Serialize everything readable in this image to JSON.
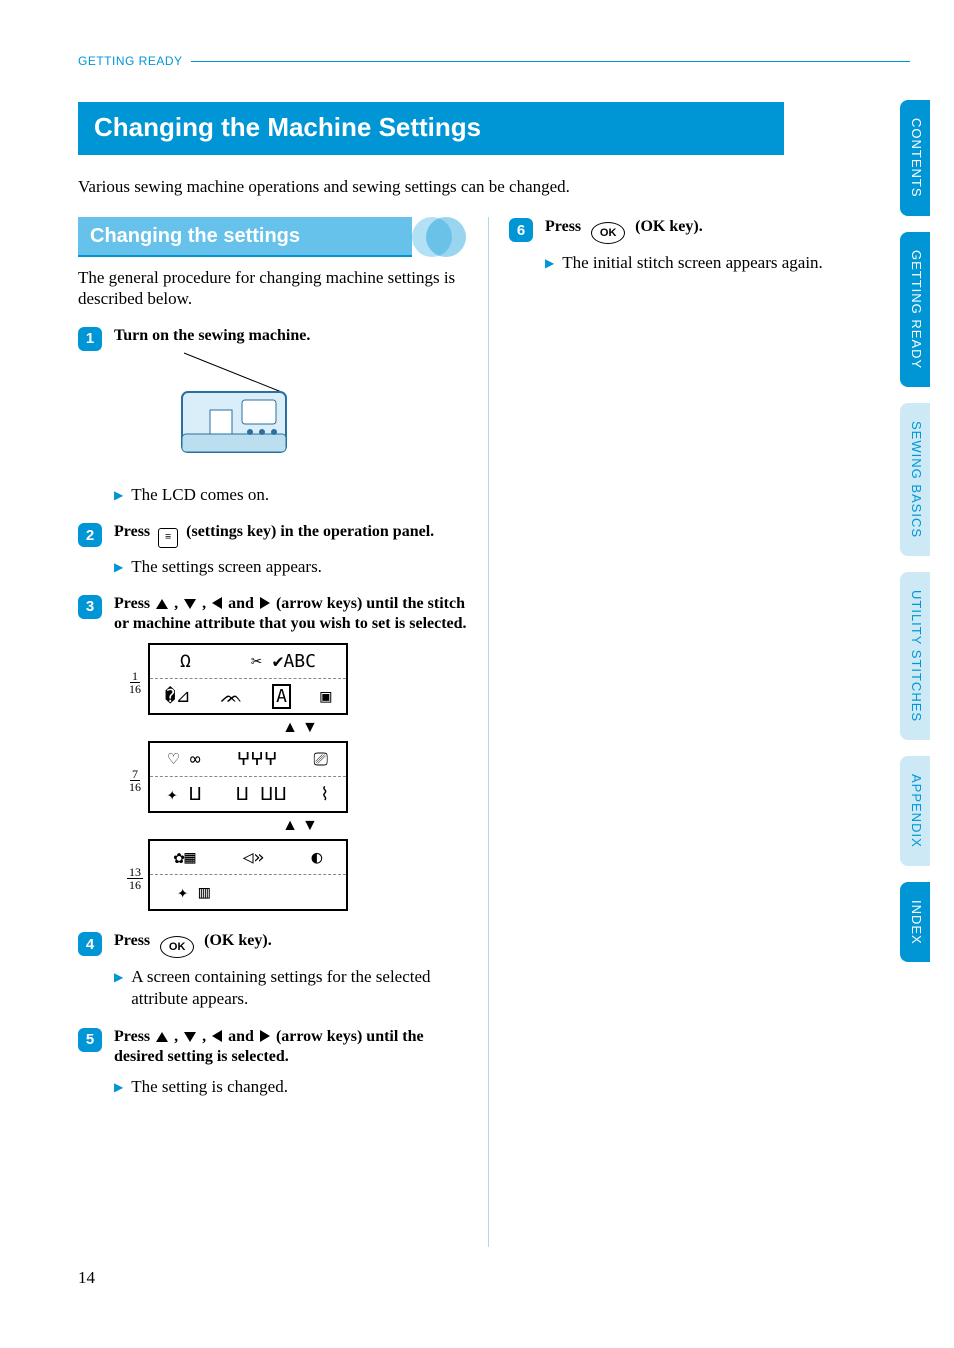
{
  "header": {
    "section": "GETTING READY"
  },
  "title": "Changing the Machine Settings",
  "intro": "Various sewing machine operations and sewing settings can be changed.",
  "subheading": "Changing the settings",
  "subintro": "The general procedure for changing machine settings is described below.",
  "steps": {
    "s1": {
      "num": "1",
      "head": "Turn on the sewing machine.",
      "result": "The LCD comes on."
    },
    "s2": {
      "num": "2",
      "head_pre": "Press ",
      "head_post": " (settings key) in the operation panel.",
      "result": "The settings screen appears."
    },
    "s3": {
      "num": "3",
      "head_pre": "Press ",
      "head_mid": " and ",
      "head_post": " (arrow keys) until the stitch or machine attribute that you wish to set is selected."
    },
    "s4": {
      "num": "4",
      "head_pre": "Press ",
      "head_post": " (OK key).",
      "result": "A screen containing settings for the selected attribute appears."
    },
    "s5": {
      "num": "5",
      "head_pre": "Press ",
      "head_mid": " and ",
      "head_post": " (arrow keys) until the desired setting is selected.",
      "result": "The setting is changed."
    },
    "s6": {
      "num": "6",
      "head_pre": "Press ",
      "head_post": " (OK key).",
      "result": "The initial stitch screen appears again."
    }
  },
  "lcd": {
    "page1": {
      "num": "1",
      "den": "16",
      "row1": "✂ ✔ABC",
      "row2_boxed": "A",
      "row2_rest": "▣"
    },
    "page2": {
      "num": "7",
      "den": "16"
    },
    "page3": {
      "num": "13",
      "den": "16"
    }
  },
  "ok_label": "OK",
  "tabs": {
    "t1": "CONTENTS",
    "t2": "GETTING READY",
    "t3": "SEWING BASICS",
    "t4": "UTILITY STITCHES",
    "t5": "APPENDIX",
    "t6": "INDEX"
  },
  "page_number": "14"
}
